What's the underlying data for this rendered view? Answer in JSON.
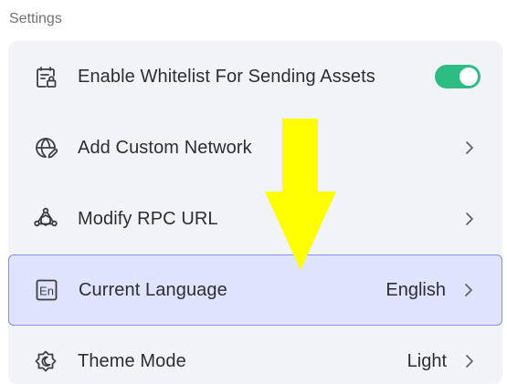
{
  "section": {
    "title": "Settings"
  },
  "rows": [
    {
      "label": "Enable Whitelist For Sending Assets",
      "icon": "whitelist-clipboard-lock-icon",
      "control": "toggle",
      "toggle_on": true
    },
    {
      "label": "Add Custom Network",
      "icon": "globe-edit-icon",
      "control": "chevron"
    },
    {
      "label": "Modify RPC URL",
      "icon": "network-nodes-icon",
      "control": "chevron"
    },
    {
      "label": "Current Language",
      "icon": "language-en-icon",
      "value": "English",
      "control": "chevron",
      "highlighted": true
    },
    {
      "label": "Theme Mode",
      "icon": "theme-mode-icon",
      "value": "Light",
      "control": "chevron"
    }
  ],
  "colors": {
    "toggle_on": "#2bbd83",
    "highlight_bg": "#dfe3fb",
    "highlight_border": "#8791df",
    "annotation_arrow": "#ffff00"
  }
}
